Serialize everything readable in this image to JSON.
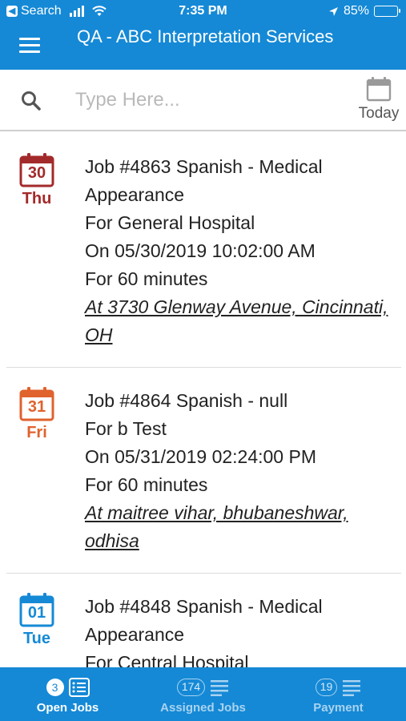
{
  "status_bar": {
    "back_label": "Search",
    "time": "7:35 PM",
    "battery": "85%",
    "battery_level": 0.85
  },
  "header": {
    "title": "QA - ABC Interpretation Services"
  },
  "search": {
    "placeholder": "Type Here...",
    "value": "",
    "today_label": "Today"
  },
  "colors": {
    "primary": "#1589d6",
    "thu": "#a32a2a",
    "fri": "#e0622d",
    "tue": "#1589d6"
  },
  "jobs": [
    {
      "cal_num": "30",
      "day": "Thu",
      "title": "Job #4863 Spanish - Medical Appearance",
      "facility": "For General Hospital",
      "datetime": "On 05/30/2019 10:02:00 AM",
      "duration": "For 60 minutes",
      "address": "At 3730 Glenway Avenue, Cincinnati, OH"
    },
    {
      "cal_num": "31",
      "day": "Fri",
      "title": "Job #4864 Spanish - null",
      "facility": "For b Test",
      "datetime": "On 05/31/2019 02:24:00 PM",
      "duration": "For 60 minutes",
      "address": "At maitree vihar, bhubaneshwar, odhisa"
    },
    {
      "cal_num": "01",
      "day": "Tue",
      "title": "Job #4848 Spanish - Medical Appearance",
      "facility": "For Central Hospital"
    }
  ],
  "tabs": [
    {
      "label": "Open Jobs",
      "count": "3",
      "icon": "list-icon",
      "active": true
    },
    {
      "label": "Assigned Jobs",
      "count": "174",
      "icon": "list-icon",
      "active": false
    },
    {
      "label": "Payment",
      "count": "19",
      "icon": "list-icon",
      "active": false
    }
  ]
}
